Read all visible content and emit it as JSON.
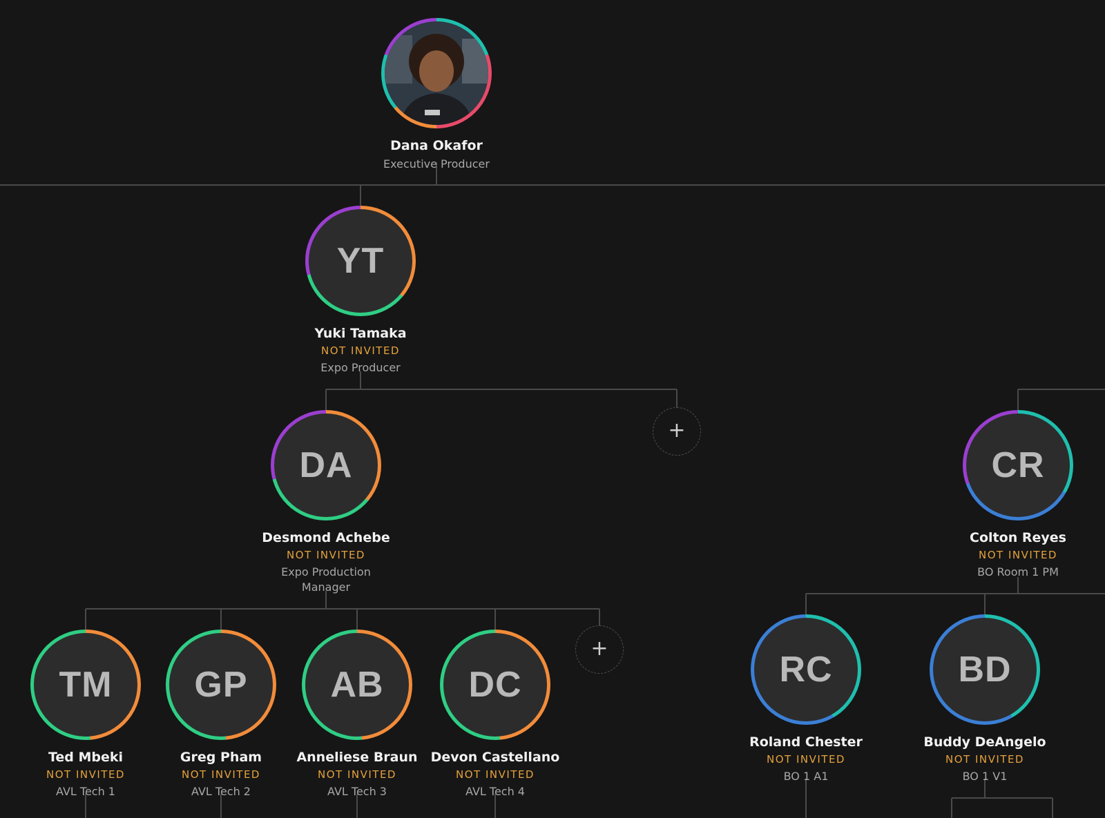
{
  "root": {
    "name": "Dana Okafor",
    "role": "Executive Producer",
    "avatar_icon": "person-photo"
  },
  "nodes": {
    "yt": {
      "initials": "YT",
      "name": "Yuki Tamaka",
      "status": "NOT INVITED",
      "role": "Expo Producer"
    },
    "da": {
      "initials": "DA",
      "name": "Desmond Achebe",
      "status": "NOT INVITED",
      "role": "Expo Production Manager"
    },
    "cr": {
      "initials": "CR",
      "name": "Colton Reyes",
      "status": "NOT INVITED",
      "role": "BO Room 1 PM"
    },
    "tm": {
      "initials": "TM",
      "name": "Ted Mbeki",
      "status": "NOT INVITED",
      "role": "AVL Tech 1"
    },
    "gp": {
      "initials": "GP",
      "name": "Greg Pham",
      "status": "NOT INVITED",
      "role": "AVL Tech 2"
    },
    "ab": {
      "initials": "AB",
      "name": "Anneliese Braun",
      "status": "NOT INVITED",
      "role": "AVL Tech 3"
    },
    "dc": {
      "initials": "DC",
      "name": "Devon Castellano",
      "status": "NOT INVITED",
      "role": "AVL Tech 4"
    },
    "rc": {
      "initials": "RC",
      "name": "Roland Chester",
      "status": "NOT INVITED",
      "role": "BO 1 A1"
    },
    "bd": {
      "initials": "BD",
      "name": "Buddy DeAngelo",
      "status": "NOT INVITED",
      "role": "BO 1 V1"
    }
  },
  "add_buttons": {
    "label": "+"
  },
  "colors": {
    "background": "#161616",
    "status": "#e6a23c",
    "connector": "#4a4a4a",
    "ring_orange": "#f28c3a",
    "ring_green": "#2fce84",
    "ring_purple": "#9b3fd0",
    "ring_teal": "#1fbfae",
    "ring_blue": "#3b7fd6"
  }
}
